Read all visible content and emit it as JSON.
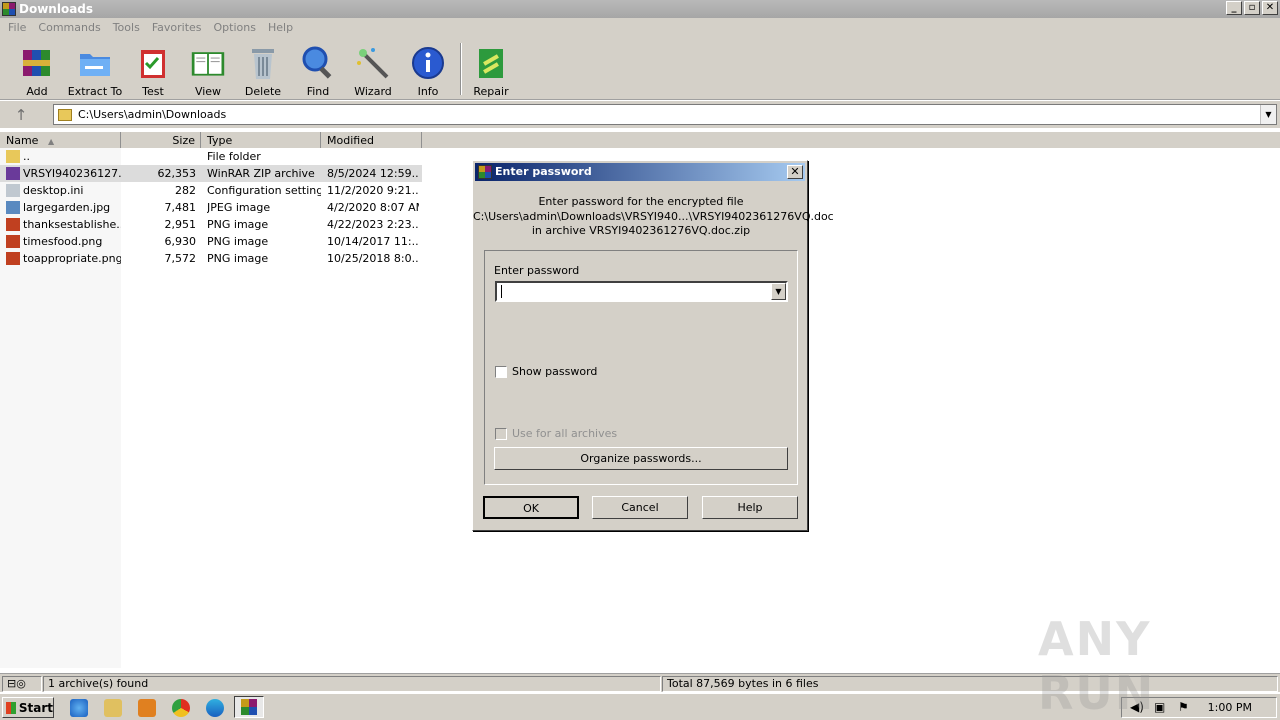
{
  "window": {
    "title": "Downloads",
    "buttons": {
      "minimize": "_",
      "restore": "▫",
      "close": "✕"
    }
  },
  "menu": [
    "File",
    "Commands",
    "Tools",
    "Favorites",
    "Options",
    "Help"
  ],
  "toolbar": [
    {
      "label": "Add",
      "icon": "add-archive-icon"
    },
    {
      "label": "Extract To",
      "icon": "extract-folder-icon"
    },
    {
      "label": "Test",
      "icon": "test-clipboard-icon"
    },
    {
      "label": "View",
      "icon": "view-book-icon"
    },
    {
      "label": "Delete",
      "icon": "trash-icon"
    },
    {
      "label": "Find",
      "icon": "magnifier-icon"
    },
    {
      "label": "Wizard",
      "icon": "wand-icon"
    },
    {
      "label": "Info",
      "icon": "info-icon"
    },
    {
      "label": "Repair",
      "icon": "repair-icon"
    }
  ],
  "address": {
    "path": "C:\\Users\\admin\\Downloads"
  },
  "columns": {
    "name": "Name",
    "size": "Size",
    "type": "Type",
    "modified": "Modified"
  },
  "files": [
    {
      "name": "..",
      "size": "",
      "type": "File folder",
      "modified": "",
      "icon": "folder-up-icon",
      "selected": false
    },
    {
      "name": "VRSYI940236127...",
      "size": "62,353",
      "type": "WinRAR ZIP archive",
      "modified": "8/5/2024 12:59...",
      "icon": "zip-archive-icon",
      "selected": true
    },
    {
      "name": "desktop.ini",
      "size": "282",
      "type": "Configuration settings",
      "modified": "11/2/2020 9:21...",
      "icon": "settings-file-icon",
      "selected": false
    },
    {
      "name": "largegarden.jpg",
      "size": "7,481",
      "type": "JPEG image",
      "modified": "4/2/2020 8:07 AM",
      "icon": "jpeg-image-icon",
      "selected": false
    },
    {
      "name": "thanksestablishe...",
      "size": "2,951",
      "type": "PNG image",
      "modified": "4/22/2023 2:23...",
      "icon": "png-image-icon",
      "selected": false
    },
    {
      "name": "timesfood.png",
      "size": "6,930",
      "type": "PNG image",
      "modified": "10/14/2017 11:...",
      "icon": "png-image-icon",
      "selected": false
    },
    {
      "name": "toappropriate.png",
      "size": "7,572",
      "type": "PNG image",
      "modified": "10/25/2018 8:0...",
      "icon": "png-image-icon",
      "selected": false
    }
  ],
  "status": {
    "left": "1 archive(s) found",
    "right": "Total 87,569 bytes in 6 files"
  },
  "dialog": {
    "title": "Enter password",
    "close": "✕",
    "message_line1": "Enter password for the encrypted file",
    "message_line2": "C:\\Users\\admin\\Downloads\\VRSYI940...\\VRSYI9402361276VQ.doc",
    "message_line3": "in archive VRSYI9402361276VQ.doc.zip",
    "field_label": "Enter password",
    "password_value": "",
    "show_password": "Show password",
    "use_for_all": "Use for all archives",
    "organize": "Organize passwords...",
    "ok": "OK",
    "cancel": "Cancel",
    "help": "Help"
  },
  "taskbar": {
    "start": "Start",
    "time": "1:00 PM"
  },
  "watermark": "ANY RUN"
}
